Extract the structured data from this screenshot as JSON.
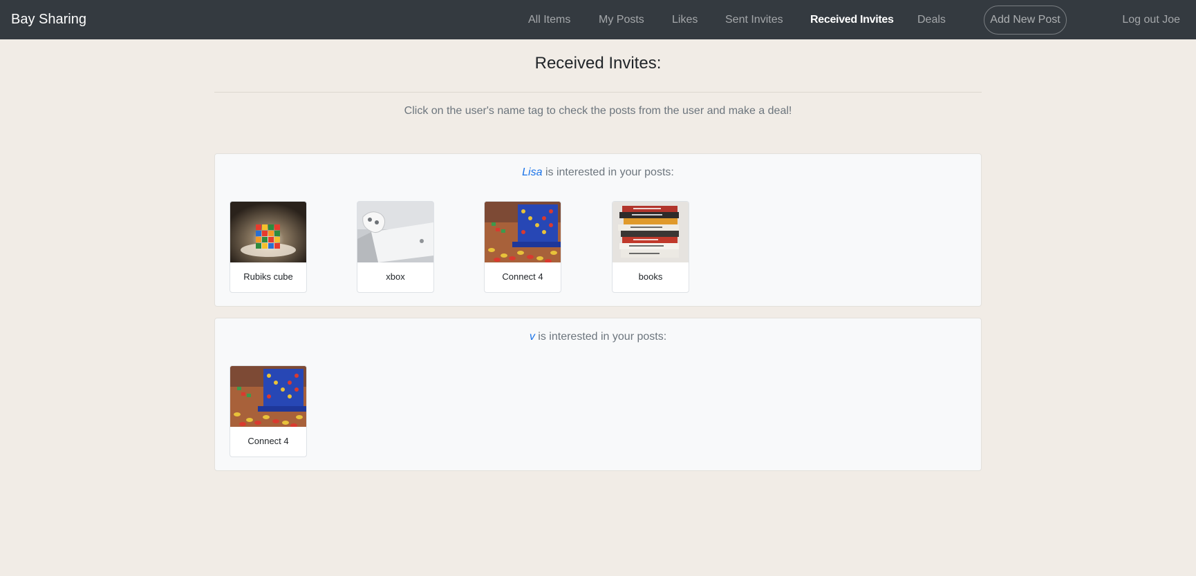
{
  "nav": {
    "brand": "Bay Sharing",
    "links": [
      {
        "label": "All Items"
      },
      {
        "label": "My Posts"
      },
      {
        "label": "Likes"
      },
      {
        "label": "Sent Invites"
      },
      {
        "label": "Received Invites",
        "active": true
      },
      {
        "label": "Deals"
      }
    ],
    "add_post": "Add New Post",
    "logout": "Log out Joe"
  },
  "header": {
    "title": "Received Invites:",
    "subtitle": "Click on the user's name tag to check the posts from the user and make a deal!"
  },
  "invites": [
    {
      "user": "Lisa",
      "suffix": " is interested in your posts:",
      "posts": [
        {
          "title": "Rubiks cube",
          "image": "rubiks-cube-image"
        },
        {
          "title": "xbox",
          "image": "xbox-image"
        },
        {
          "title": "Connect 4",
          "image": "connect-4-image"
        },
        {
          "title": "books",
          "image": "books-image"
        }
      ]
    },
    {
      "user": "v",
      "suffix": " is interested in your posts:",
      "posts": [
        {
          "title": "Connect 4",
          "image": "connect-4-image"
        }
      ]
    }
  ],
  "colors": {
    "navbar": "#343a40",
    "page_bg": "#f1ece6",
    "user_link": "#1a73e8"
  }
}
